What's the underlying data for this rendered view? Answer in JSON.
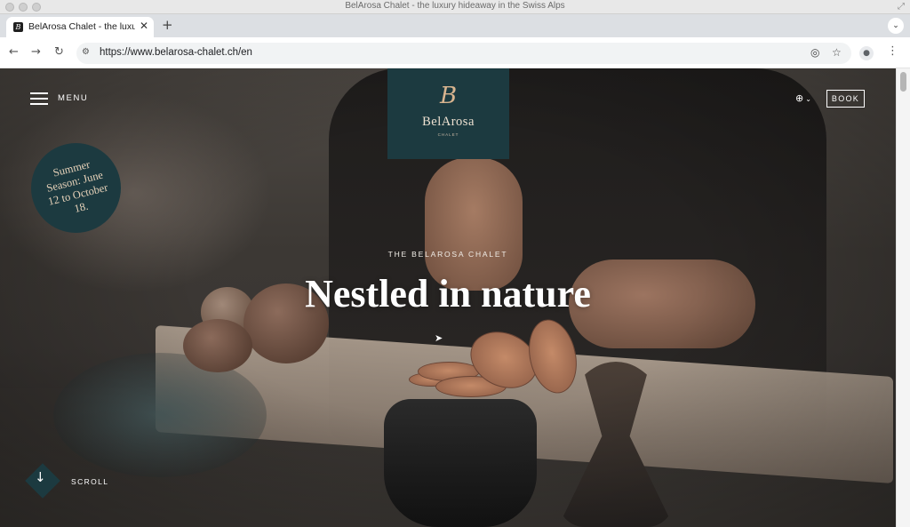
{
  "window": {
    "title": "BelArosa Chalet - the luxury hideaway in the Swiss Alps"
  },
  "browser": {
    "tab_title": "BelArosa Chalet - the luxury",
    "tab_favicon": "B",
    "url": "https://www.belarosa-chalet.ch/en",
    "icons": {
      "back": "back-arrow-icon",
      "forward": "forward-arrow-icon",
      "reload": "reload-icon",
      "site_info": "tune-icon",
      "eye_off": "eye-off-icon",
      "bookmark": "star-icon",
      "profile": "profile-icon",
      "menu": "kebab-icon"
    }
  },
  "site": {
    "menu_label": "MENU",
    "logo_mark": "B",
    "logo_name": "BelArosa",
    "logo_sub": "CHALET",
    "book_label": "BOOK",
    "language_icon": "globe-icon",
    "season_badge": "Summer Season: June 12 to October 18.",
    "hero_eyebrow": "THE BELAROSA CHALET",
    "hero_headline": "Nestled in nature",
    "scroll_label": "SCROLL"
  },
  "colors": {
    "brand_teal": "#1c3a40",
    "brand_gold": "#d8b48f",
    "text_white": "#ffffff"
  }
}
